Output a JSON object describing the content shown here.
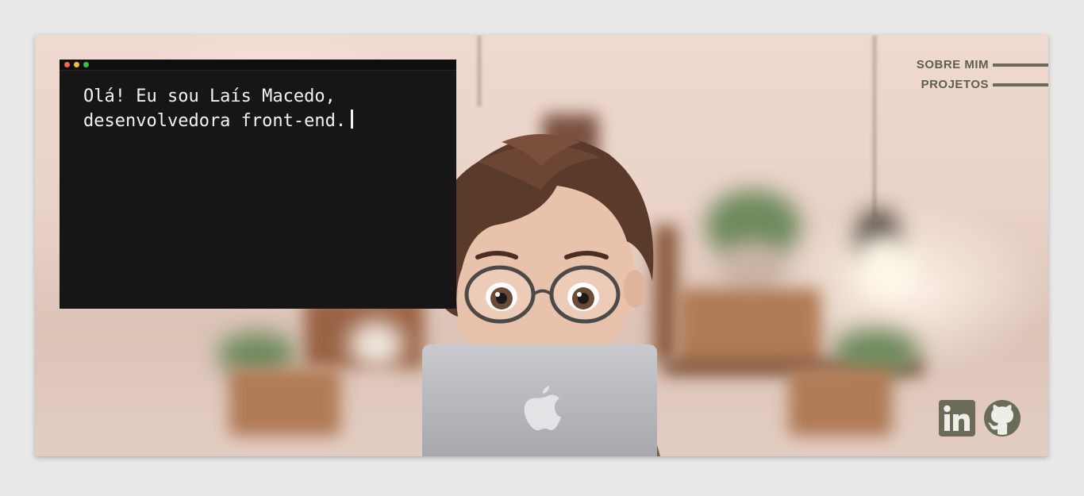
{
  "terminal": {
    "line1": "Olá! Eu sou Laís Macedo,",
    "line2": "desenvolvedora front-end."
  },
  "nav": {
    "items": [
      {
        "label": "SOBRE MIM"
      },
      {
        "label": "PROJETOS"
      }
    ]
  },
  "colors": {
    "accent": "#6b6c58",
    "nav_text": "#5e5f4c",
    "terminal_bg": "#161616",
    "dot_red": "#ff5f57",
    "dot_yellow": "#febc2e",
    "dot_green": "#28c840"
  },
  "icons": {
    "linkedin": "linkedin-icon",
    "github": "github-icon"
  }
}
